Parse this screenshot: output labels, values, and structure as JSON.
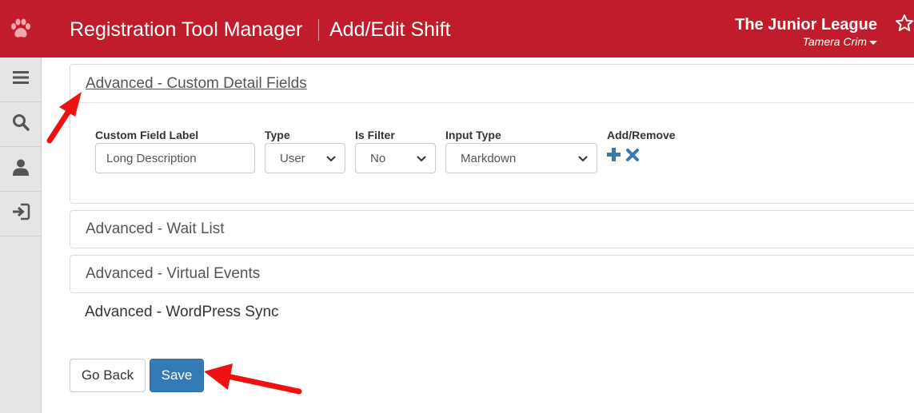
{
  "header": {
    "app_title": "Registration Tool Manager",
    "page_title": "Add/Edit Shift",
    "org_name": "The Junior League",
    "user_name": "Tamera Crim"
  },
  "sidebar": {
    "items": [
      {
        "icon": "menu-icon"
      },
      {
        "icon": "search-icon"
      },
      {
        "icon": "user-icon"
      },
      {
        "icon": "logout-icon"
      }
    ]
  },
  "sections": {
    "custom_fields": {
      "title": "Advanced - Custom Detail Fields",
      "columns": {
        "label": "Custom Field Label",
        "type": "Type",
        "is_filter": "Is Filter",
        "input_type": "Input Type",
        "add_remove": "Add/Remove"
      },
      "row": {
        "label_value": "Long Description",
        "type_value": "User",
        "is_filter_value": "No",
        "input_type_value": "Markdown"
      }
    },
    "wait_list": {
      "title": "Advanced - Wait List"
    },
    "virtual_events": {
      "title": "Advanced - Virtual Events"
    },
    "wordpress_sync": {
      "title": "Advanced - WordPress Sync"
    }
  },
  "actions": {
    "back_label": "Go Back",
    "save_label": "Save"
  },
  "colors": {
    "brand_red": "#c01c2c",
    "primary_blue": "#337ab7",
    "annotation_red": "#ee1111"
  }
}
